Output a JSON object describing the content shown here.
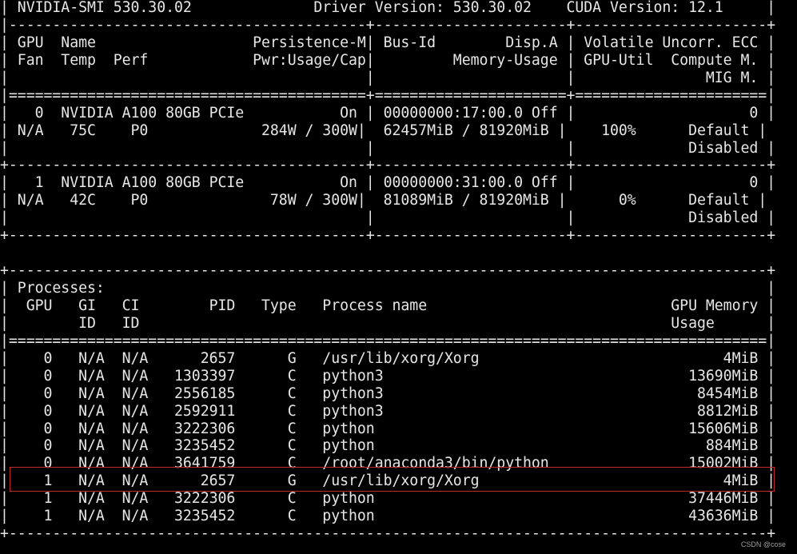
{
  "window": {
    "title": "NVIDIA-SMI 530.30.02",
    "driver_version": "530.30.02",
    "cuda_version": "12.1",
    "highlight_color": "#c0282d",
    "background": "#000000",
    "text_color": "#e6e6e6"
  },
  "terminal_lines": [
    "| NVIDIA-SMI 530.30.02              Driver Version: 530.30.02    CUDA Version: 12.1     |",
    "|-----------------------------------------+----------------------+----------------------+",
    "| GPU  Name                  Persistence-M| Bus-Id        Disp.A | Volatile Uncorr. ECC |",
    "| Fan  Temp  Perf            Pwr:Usage/Cap|         Memory-Usage | GPU-Util  Compute M. |",
    "|                                         |                      |               MIG M. |",
    "|=========================================+======================+======================|",
    "|   0  NVIDIA A100 80GB PCIe           On | 00000000:17:00.0 Off |                    0 |",
    "| N/A   75C    P0             284W / 300W|  62457MiB / 81920MiB |    100%      Default |",
    "|                                         |                      |             Disabled |",
    "+-----------------------------------------+----------------------+----------------------+",
    "|   1  NVIDIA A100 80GB PCIe           On | 00000000:31:00.0 Off |                    0 |",
    "| N/A   42C    P0              78W / 300W|  81089MiB / 81920MiB |      0%      Default |",
    "|                                         |                      |             Disabled |",
    "+-----------------------------------------+----------------------+----------------------+",
    "",
    "+---------------------------------------------------------------------------------------+",
    "| Processes:                                                                            |",
    "|  GPU   GI   CI        PID   Type   Process name                            GPU Memory |",
    "|        ID   ID                                                             Usage      |",
    "|=======================================================================================|",
    "|    0   N/A  N/A      2657      G   /usr/lib/xorg/Xorg                            4MiB |",
    "|    0   N/A  N/A   1303397      C   python3                                   13690MiB |",
    "|    0   N/A  N/A   2556185      C   python3                                    8454MiB |",
    "|    0   N/A  N/A   2592911      C   python3                                    8812MiB |",
    "|    0   N/A  N/A   3222306      C   python                                    15606MiB |",
    "|    0   N/A  N/A   3235452      C   python                                      884MiB |",
    "|    0   N/A  N/A   3641759      C   /root/anaconda3/bin/python                15002MiB |",
    "|    1   N/A  N/A      2657      G   /usr/lib/xorg/Xorg                            4MiB |",
    "|    1   N/A  N/A   3222306      C   python                                    37446MiB |",
    "|    1   N/A  N/A   3235452      C   python                                    43636MiB |",
    "+---------------------------------------------------------------------------------------+"
  ],
  "gpus": [
    {
      "index": "0",
      "name": "NVIDIA A100 80GB PCIe",
      "persistence": "On",
      "bus_id": "00000000:17:00.0",
      "disp": "Off",
      "ecc": "0",
      "fan": "N/A",
      "temp": "75C",
      "perf": "P0",
      "power": "284W / 300W",
      "memory": "62457MiB / 81920MiB",
      "util": "100%",
      "compute": "Default",
      "mig": "Disabled"
    },
    {
      "index": "1",
      "name": "NVIDIA A100 80GB PCIe",
      "persistence": "On",
      "bus_id": "00000000:31:00.0",
      "disp": "Off",
      "ecc": "0",
      "fan": "N/A",
      "temp": "42C",
      "perf": "P0",
      "power": "78W / 300W",
      "memory": "81089MiB / 81920MiB",
      "util": "0%",
      "compute": "Default",
      "mig": "Disabled"
    }
  ],
  "processes": [
    {
      "gpu": "0",
      "gi": "N/A",
      "ci": "N/A",
      "pid": "2657",
      "type": "G",
      "name": "/usr/lib/xorg/Xorg",
      "mem": "4MiB"
    },
    {
      "gpu": "0",
      "gi": "N/A",
      "ci": "N/A",
      "pid": "1303397",
      "type": "C",
      "name": "python3",
      "mem": "13690MiB"
    },
    {
      "gpu": "0",
      "gi": "N/A",
      "ci": "N/A",
      "pid": "2556185",
      "type": "C",
      "name": "python3",
      "mem": "8454MiB"
    },
    {
      "gpu": "0",
      "gi": "N/A",
      "ci": "N/A",
      "pid": "2592911",
      "type": "C",
      "name": "python3",
      "mem": "8812MiB"
    },
    {
      "gpu": "0",
      "gi": "N/A",
      "ci": "N/A",
      "pid": "3222306",
      "type": "C",
      "name": "python",
      "mem": "15606MiB"
    },
    {
      "gpu": "0",
      "gi": "N/A",
      "ci": "N/A",
      "pid": "3235452",
      "type": "C",
      "name": "python",
      "mem": "884MiB"
    },
    {
      "gpu": "0",
      "gi": "N/A",
      "ci": "N/A",
      "pid": "3641759",
      "type": "C",
      "name": "/root/anaconda3/bin/python",
      "mem": "15002MiB"
    },
    {
      "gpu": "1",
      "gi": "N/A",
      "ci": "N/A",
      "pid": "2657",
      "type": "G",
      "name": "/usr/lib/xorg/Xorg",
      "mem": "4MiB"
    },
    {
      "gpu": "1",
      "gi": "N/A",
      "ci": "N/A",
      "pid": "3222306",
      "type": "C",
      "name": "python",
      "mem": "37446MiB"
    },
    {
      "gpu": "1",
      "gi": "N/A",
      "ci": "N/A",
      "pid": "3235452",
      "type": "C",
      "name": "python",
      "mem": "43636MiB"
    }
  ],
  "watermark": "CSDN @cose"
}
